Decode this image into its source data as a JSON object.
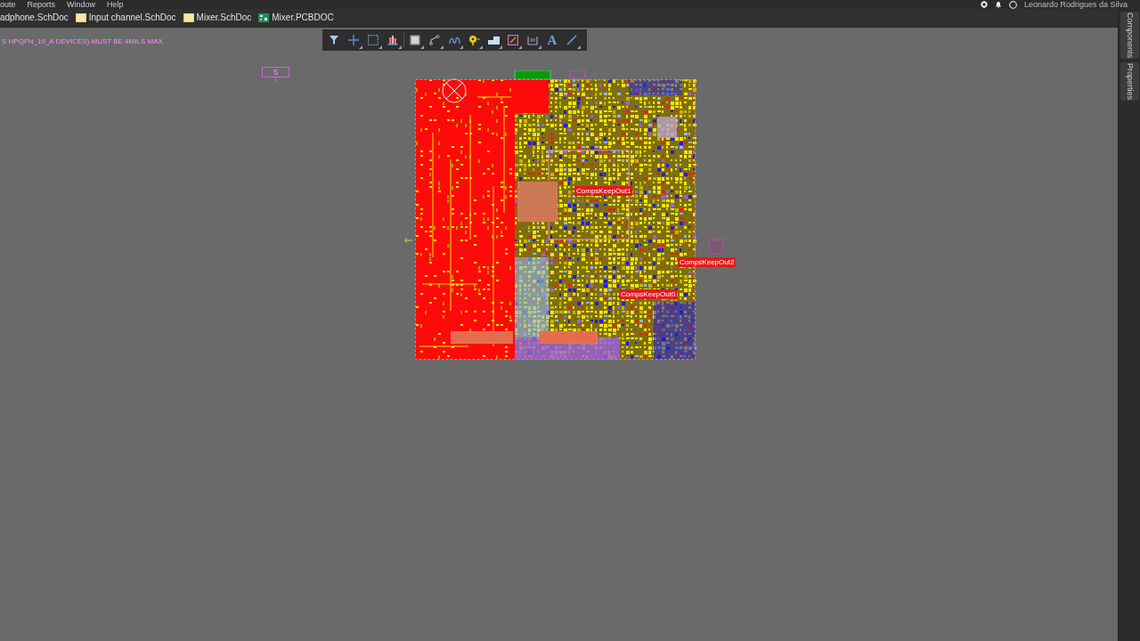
{
  "menu_bar": {
    "menus": [
      "oute",
      "Reports",
      "Window",
      "Help"
    ],
    "user_name": "Leonardo Rodrigues da Silva"
  },
  "document_tabs": [
    {
      "label": "adphone.SchDoc"
    },
    {
      "label": "Input channel.SchDoc",
      "kind": "schematic"
    },
    {
      "label": "Mixer.SchDoc",
      "kind": "schematic"
    },
    {
      "label": "Mixer.PCBDOC",
      "kind": "pcb"
    }
  ],
  "toolbar": {
    "text_tool": "A"
  },
  "canvas": {
    "note": "S HPQFN_19_A DEVICES) MUST BE 4MILS MAX.",
    "designator": "5",
    "keepout_labels": [
      "CompsKeepOut1",
      "CompsKeepOut2",
      "CompsKeepOut0"
    ]
  },
  "side_panel_tabs": [
    "Components",
    "Properties"
  ]
}
